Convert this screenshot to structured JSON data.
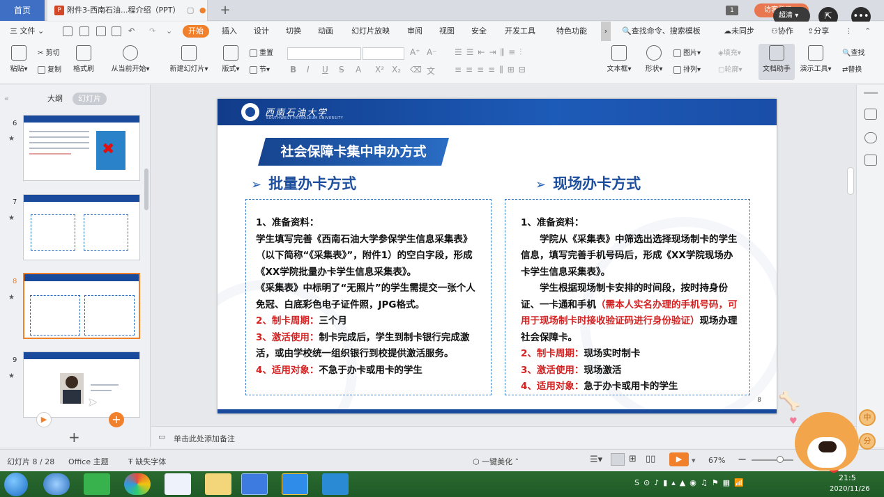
{
  "tabs": {
    "home": "首页",
    "doc_title": "附件3-西南石油...程介绍（PPT）",
    "doc_icon": "P",
    "new_tab": "+",
    "page_badge": "1",
    "visitor": "访客登录",
    "hd_label": "超清"
  },
  "menu": {
    "file": "三 文件",
    "active": "开始",
    "items": [
      "插入",
      "设计",
      "切换",
      "动画",
      "幻灯片放映",
      "审阅",
      "视图",
      "安全",
      "开发工具",
      "特色功能"
    ],
    "search": "查找命令、搜索模板",
    "unsync": "未同步",
    "collab": "协作",
    "share": "分享"
  },
  "ribbon": {
    "paste": "粘贴",
    "cut": "剪切",
    "copy": "复制",
    "format_painter": "格式刷",
    "from_current": "从当前开始",
    "new_slide": "新建幻灯片",
    "layout": "版式",
    "reset": "重置",
    "section": "节",
    "textbox": "文本框",
    "shape": "形状",
    "picture": "图片",
    "fill": "填充",
    "arrange": "排列",
    "outline": "轮廓",
    "doc_helper": "文档助手",
    "present_tools": "演示工具",
    "find": "查找",
    "replace": "替换",
    "font_glyphs": [
      "B",
      "I",
      "U",
      "S",
      "A",
      "X²",
      "X₂"
    ]
  },
  "left_panel": {
    "tab_outline": "大纲",
    "tab_slides": "幻灯片",
    "collapse": "«",
    "slides": [
      {
        "num": "6",
        "star": "★"
      },
      {
        "num": "7",
        "star": "★"
      },
      {
        "num": "8",
        "star": "★"
      },
      {
        "num": "9",
        "star": "★"
      }
    ],
    "add": "+"
  },
  "slide": {
    "university": "西南石油大学",
    "university_en": "SOUTHWEST PETROLEUM UNIVERSITY",
    "banner": "社会保障卡集中申办方式",
    "left_heading": "批量办卡方式",
    "right_heading": "现场办卡方式",
    "arrow": "➢",
    "left": {
      "l1": "1、准备资料：",
      "l2": "学生填写完善《西南石油大学参保学生信息采集表》（以下简称“《采集表》”，附件1）的空白字段，形成《XX学院批量办卡学生信息采集表》。",
      "l3": "《采集表》中标明了“无照片”的学生需提交一张个人免冠、白底彩色电子证件照，JPG格式。",
      "l4a": "2、制卡周期：",
      "l4b": "三个月",
      "l5a": "3、激活使用：",
      "l5b": "制卡完成后，学生到制卡银行完成激活，或由学校统一组织银行到校提供激活服务。",
      "l6a": "4、适用对象：",
      "l6b": "不急于办卡或用卡的学生"
    },
    "right": {
      "r1": "1、准备资料：",
      "r2": "学院从《采集表》中筛选出选择现场制卡的学生信息，填写完善手机号码后，形成《XX学院现场办卡学生信息采集表》。",
      "r3a": "学生根据现场制卡安排的时间段，按时持身份证、一卡通和手机",
      "r3b": "（需本人实名办理的手机号码，可用于现场制卡时接收验证码进行身份验证）",
      "r3c": "现场办理社会保障卡。",
      "r4a": "2、制卡周期：",
      "r4b": "现场实时制卡",
      "r5a": "3、激活使用：",
      "r5b": "现场激活",
      "r6a": "4、适用对象：",
      "r6b": "急于办卡或用卡的学生"
    },
    "page_no": "8"
  },
  "notes": {
    "placeholder": "单击此处添加备注"
  },
  "status": {
    "slide_counter": "幻灯片 8 / 28",
    "theme": "Office 主题",
    "missing_font": "缺失字体",
    "beautify": "一键美化",
    "zoom": "67%"
  },
  "taskbar": {
    "time": "21:5",
    "date": "2020/11/26",
    "badge": "2"
  },
  "mascot": {
    "coin1": "中",
    "coin2": "分"
  },
  "colors": {
    "accent": "#f0802b",
    "slide_blue": "#1d4f9e",
    "slide_red": "#d42222"
  }
}
